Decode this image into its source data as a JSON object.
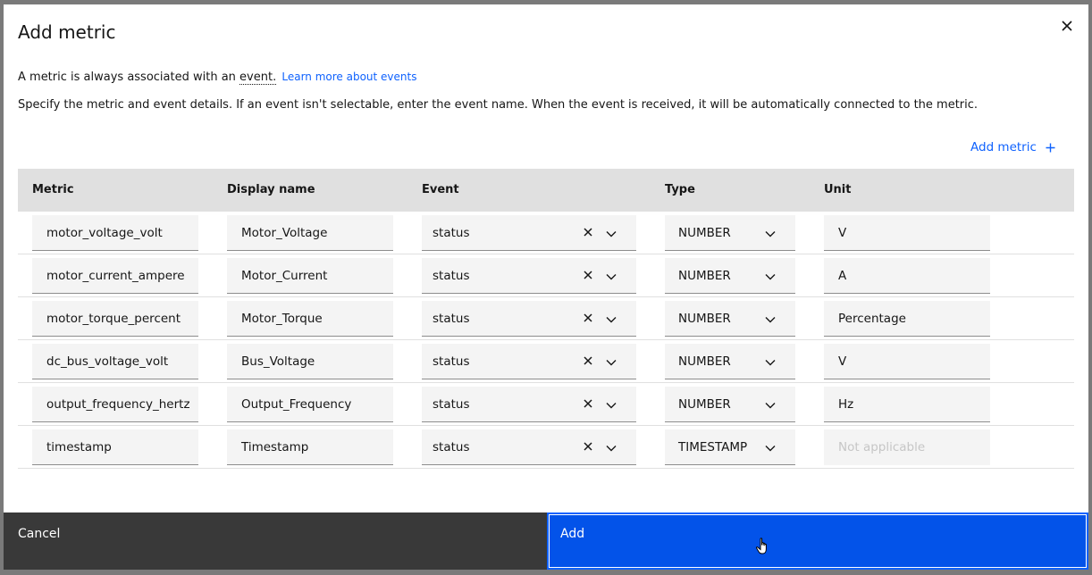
{
  "modal": {
    "title": "Add metric",
    "intro_text": "A metric is always associated with an ",
    "intro_term": "event.",
    "intro_link": "Learn more about events",
    "description": "Specify the metric and event details. If an event isn't selectable, enter the event name. When the event is received, it will be automatically connected to the metric.",
    "add_metric_label": "Add metric"
  },
  "table": {
    "headers": [
      "Metric",
      "Display name",
      "Event",
      "Type",
      "Unit"
    ],
    "rows": [
      {
        "metric": "motor_voltage_volt",
        "display": "Motor_Voltage",
        "event": "status",
        "type": "NUMBER",
        "unit": "V"
      },
      {
        "metric": "motor_current_ampere",
        "display": "Motor_Current",
        "event": "status",
        "type": "NUMBER",
        "unit": "A"
      },
      {
        "metric": "motor_torque_percent",
        "display": "Motor_Torque",
        "event": "status",
        "type": "NUMBER",
        "unit": "Percentage"
      },
      {
        "metric": "dc_bus_voltage_volt",
        "display": "Bus_Voltage",
        "event": "status",
        "type": "NUMBER",
        "unit": "V"
      },
      {
        "metric": "output_frequency_hertz",
        "display": "Output_Frequency",
        "event": "status",
        "type": "NUMBER",
        "unit": "Hz"
      },
      {
        "metric": "timestamp",
        "display": "Timestamp",
        "event": "status",
        "type": "TIMESTAMP",
        "unit": "Not applicable"
      }
    ]
  },
  "footer": {
    "cancel_label": "Cancel",
    "add_label": "Add"
  },
  "colors": {
    "primary": "#0f62fe",
    "add_button": "#0353e9",
    "cancel_button": "#393939",
    "header_bg": "#e0e0e0",
    "field_bg": "#f4f4f4"
  },
  "icons": {
    "close": "close-icon",
    "add": "plus-icon",
    "clear": "clear-icon",
    "dropdown": "chevron-down-icon",
    "cursor": "hand-pointer-icon"
  }
}
